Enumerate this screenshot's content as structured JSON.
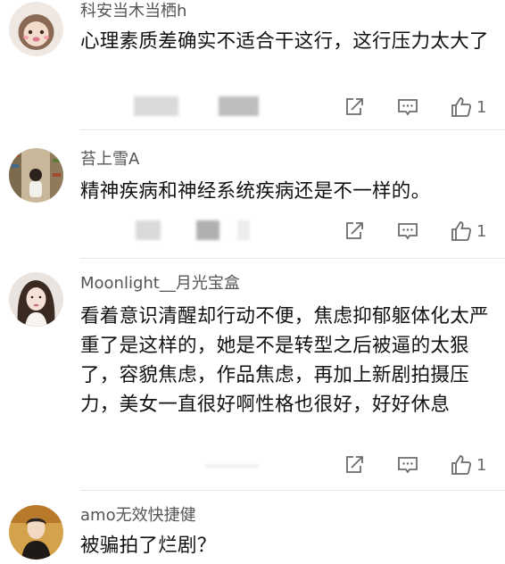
{
  "comments": [
    {
      "username": "科安当木当栖h",
      "content": "心理素质差确实不适合干这行，这行压力太大了",
      "like_count": "1",
      "icons": {
        "share": "share-icon",
        "reply": "comment-icon",
        "like": "thumbs-up-icon"
      }
    },
    {
      "username": "苔上雪A",
      "content": "精神疾病和神经系统疾病还是不一样的。",
      "like_count": "1",
      "icons": {
        "share": "share-icon",
        "reply": "comment-icon",
        "like": "thumbs-up-icon"
      }
    },
    {
      "username": "Moonlight__月光宝盒",
      "content": "看着意识清醒却行动不便，焦虑抑郁躯体化太严重了是这样的，她是不是转型之后被逼的太狠了，容貌焦虑，作品焦虑，再加上新剧拍摄压力，美女一直很好啊性格也很好，好好休息",
      "like_count": "1",
      "icons": {
        "share": "share-icon",
        "reply": "comment-icon",
        "like": "thumbs-up-icon"
      }
    },
    {
      "username": "amo无效快捷健",
      "content": "被骗拍了烂剧？"
    }
  ],
  "colors": {
    "username": "#555555",
    "content": "#111111",
    "icon": "#6b6b6b",
    "divider": "#e6e6e6"
  }
}
